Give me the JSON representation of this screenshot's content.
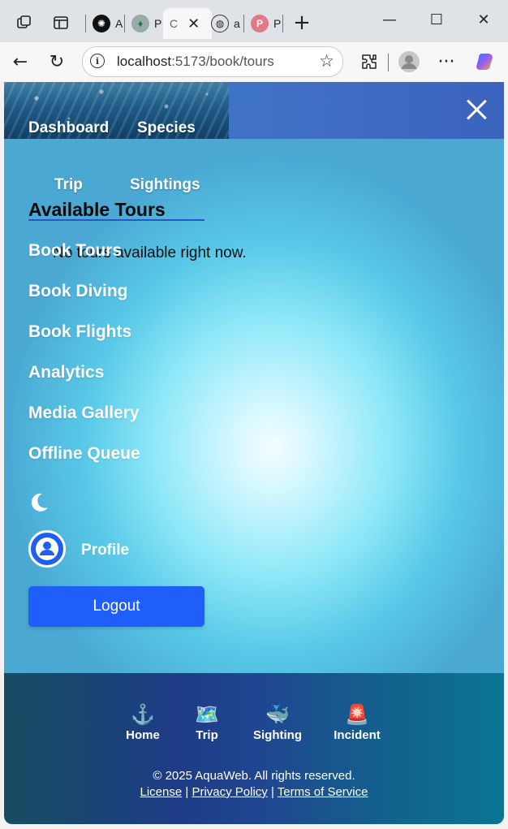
{
  "browser": {
    "tabs": [
      {
        "label": "A",
        "icon": "openai-icon"
      },
      {
        "label": "P",
        "icon": "mongodb-leaf-icon"
      },
      {
        "label": "a",
        "icon": "globe-icon"
      },
      {
        "label": "P",
        "icon": "pinterest-icon"
      }
    ],
    "active_tab_label": "C",
    "url_host": "localhost",
    "url_path": ":5173/book/tours"
  },
  "nav": {
    "dashboard": "Dashboard",
    "species": "Species",
    "trip": "Trip",
    "sightings": "Sightings"
  },
  "main": {
    "title": "Available Tours",
    "empty_message": "No tours available right now."
  },
  "menu": {
    "items": [
      "Book Tours",
      "Book Diving",
      "Book Flights",
      "Analytics",
      "Media Gallery",
      "Offline Queue"
    ],
    "profile": "Profile",
    "logout": "Logout"
  },
  "footer": {
    "nav": [
      {
        "icon": "⚓",
        "label": "Home"
      },
      {
        "icon": "🗺️",
        "label": "Trip"
      },
      {
        "icon": "🐳",
        "label": "Sighting"
      },
      {
        "icon": "🚨",
        "label": "Incident"
      }
    ],
    "copyright": "© 2025 AquaWeb. All rights reserved.",
    "links": [
      "License",
      "Privacy Policy",
      "Terms of Service"
    ]
  },
  "colors": {
    "primary_button": "#1f5ef8",
    "header_blue": "#3d7fc8"
  }
}
